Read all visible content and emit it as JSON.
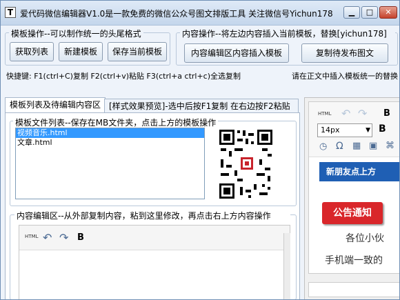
{
  "window": {
    "title": "爱代码微信编辑器V1.0是一款免费的微信公众号图文排版工具 关注微信号Yichun178",
    "icon_letter": "T",
    "min_glyph": "▁",
    "max_glyph": "□",
    "close_glyph": "✕"
  },
  "template_ops": {
    "label": "模板操作--可以制作统一的头尾格式",
    "get_list": "获取列表",
    "new_template": "新建模板",
    "save_template": "保存当前模板"
  },
  "content_ops": {
    "label": "内容操作--将左边内容插入当前模板，替换[yichun178]",
    "insert_button": "内容编辑区内容插入模板",
    "copy_button": "复制待发布图文"
  },
  "shortcuts": "快捷键: F1(ctrl+C)复制 F2(ctrl+v)粘贴 F3(ctrl+a ctrl+c)全选复制",
  "right_hint": "请在正文中插入模板统一的替换",
  "tabs": {
    "list_tab": "模板列表及待编辑内容区",
    "preview_tab": "[样式效果预览]-选中后按F1复制 在右边按F2粘贴"
  },
  "file_list": {
    "label": "模板文件列表--保存在MB文件夹，点击上方的模板操作",
    "items": [
      "视频音乐.html",
      "文章.html"
    ],
    "selected_index": 0
  },
  "editor": {
    "label": "内容编辑区--从外部复制内容，粘到这里修改，再点击右上方内容操作",
    "html_label": "HTML",
    "undo_glyph": "↶",
    "redo_glyph": "↷",
    "bold_glyph": "B"
  },
  "right_panel": {
    "html_label": "HTML",
    "font_size": "14px",
    "omega_glyph": "Ω",
    "bold_glyph": "B",
    "banner": "新朋友点上方",
    "notice": "公告通知",
    "line1": "各位小伙",
    "line2": "手机端一致的"
  },
  "colors": {
    "banner_blue": "#1f5fb4",
    "notice_red": "#d9262a",
    "selection": "#3399ff"
  }
}
